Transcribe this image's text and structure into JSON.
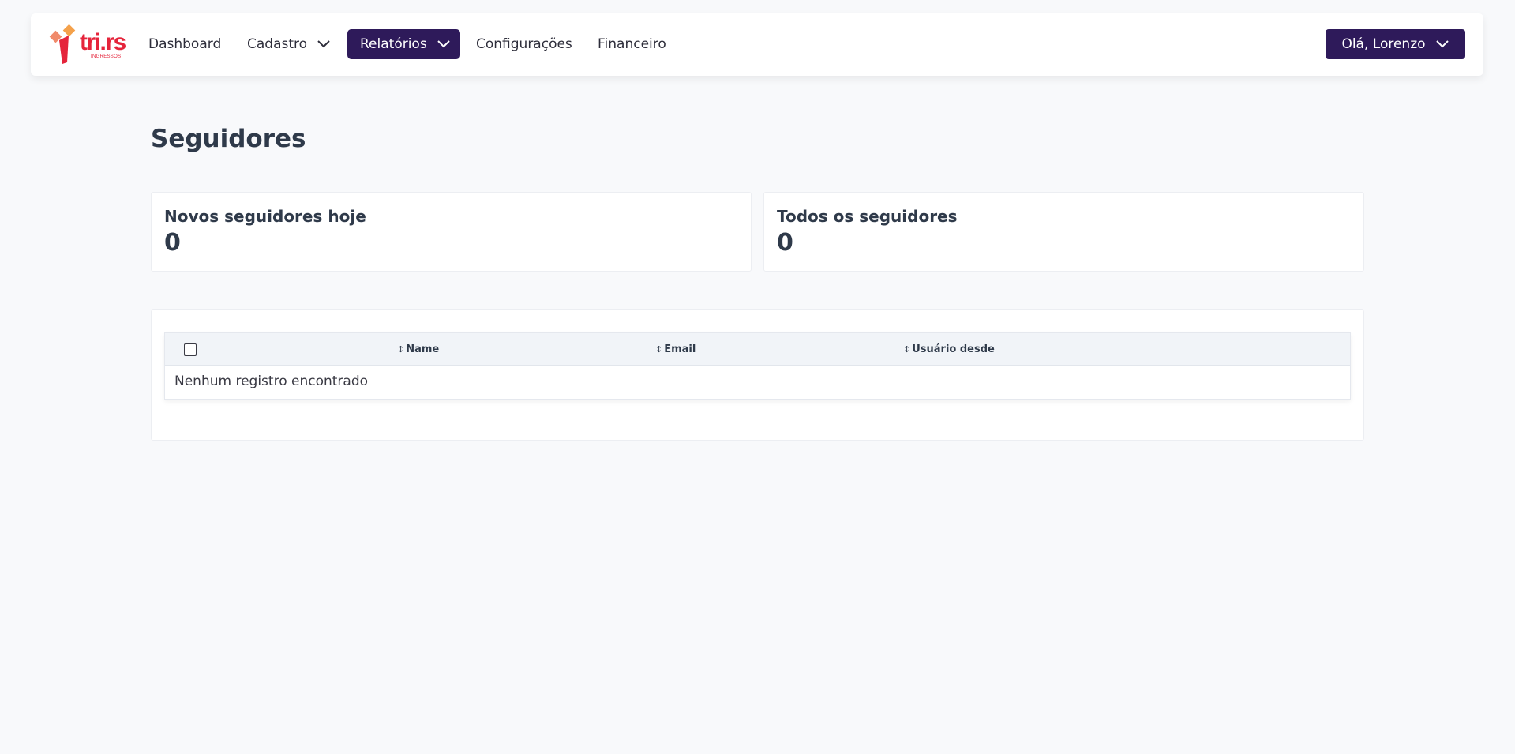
{
  "brand": {
    "name": "tri.rs",
    "tagline": "INGRESSOS",
    "colors": {
      "primary": "#e5243b",
      "accent": "#f4a14b",
      "dark": "#2e1a5a"
    }
  },
  "nav": {
    "items": [
      {
        "label": "Dashboard"
      },
      {
        "label": "Cadastro",
        "icon": "chevron-down-icon"
      },
      {
        "label": "Relatórios",
        "icon": "chevron-down-icon",
        "active": true
      },
      {
        "label": "Configurações"
      },
      {
        "label": "Financeiro"
      }
    ],
    "user_label": "Olá, Lorenzo"
  },
  "page": {
    "title": "Seguidores"
  },
  "stats": [
    {
      "label": "Novos seguidores hoje",
      "value": "0"
    },
    {
      "label": "Todos os seguidores",
      "value": "0"
    }
  ],
  "table": {
    "sort_glyph": "↕",
    "columns": [
      "Name",
      "Email",
      "Usuário desde"
    ],
    "empty_message": "Nenhum registro encontrado"
  }
}
